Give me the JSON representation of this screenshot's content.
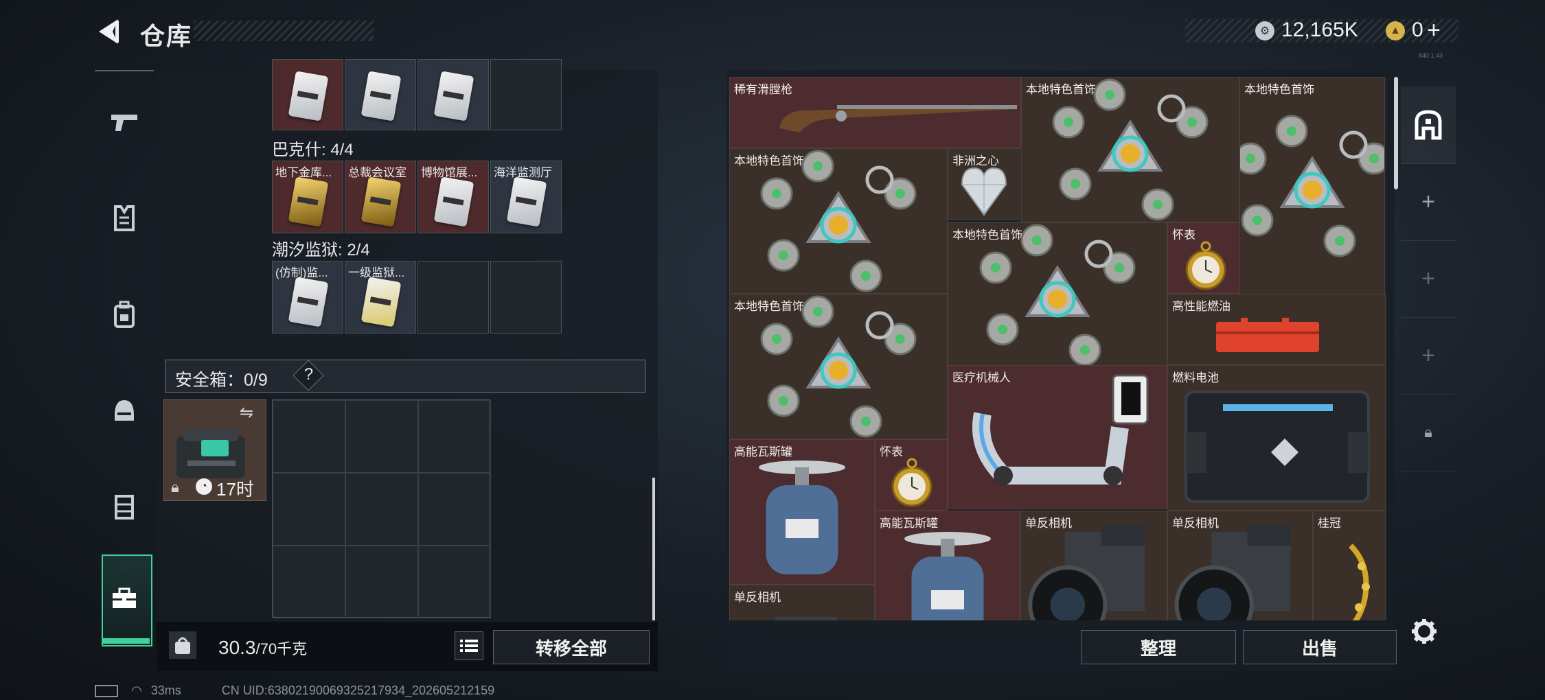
{
  "header": {
    "title": "仓库",
    "currency_main": "12,165K",
    "currency_secondary": "0",
    "add_label": "+",
    "version": "840.1.43"
  },
  "left_nav": {
    "items": [
      {
        "name": "weapon",
        "icon": "pistol-icon"
      },
      {
        "name": "armor",
        "icon": "vest-icon"
      },
      {
        "name": "backpack",
        "icon": "backpack-icon"
      },
      {
        "name": "helmet",
        "icon": "helmet-icon"
      },
      {
        "name": "chest-rig",
        "icon": "rig-icon"
      },
      {
        "name": "safe-case",
        "icon": "briefcase-icon",
        "active": true
      }
    ]
  },
  "left_panel": {
    "top_row": [
      "",
      "",
      ""
    ],
    "bakeshi": {
      "label": "巴克什: 4/4",
      "cards": [
        "地下金库...",
        "总裁会议室",
        "博物馆展...",
        "海洋监测厅"
      ]
    },
    "chaoxi": {
      "label": "潮汐监狱: 2/4",
      "cards": [
        "(仿制)监...",
        "一级监狱..."
      ]
    },
    "safe_box": {
      "label": "安全箱：0/9",
      "help": "?",
      "timer": "17时",
      "swap_icon": "swap-icon"
    },
    "weight": {
      "current": "30.3",
      "max": "/70千克"
    },
    "transfer_all": "转移全部"
  },
  "right_panel": {
    "items": [
      {
        "label": "稀有滑膛枪",
        "type": "musket"
      },
      {
        "label": "本地特色首饰",
        "type": "jewelry"
      },
      {
        "label": "本地特色首饰",
        "type": "jewelry"
      },
      {
        "label": "本地特色首饰",
        "type": "jewelry"
      },
      {
        "label": "非洲之心",
        "type": "gem"
      },
      {
        "label": "本地特色首饰",
        "type": "jewelry"
      },
      {
        "label": "怀表",
        "type": "watch"
      },
      {
        "label": "本地特色首饰",
        "type": "jewelry"
      },
      {
        "label": "高性能燃油",
        "type": "fuel"
      },
      {
        "label": "医疗机械人",
        "type": "robot"
      },
      {
        "label": "燃料电池",
        "type": "battery"
      },
      {
        "label": "高能瓦斯罐",
        "type": "gas"
      },
      {
        "label": "怀表",
        "type": "watch"
      },
      {
        "label": "高能瓦斯罐",
        "type": "gas"
      },
      {
        "label": "单反相机",
        "type": "camera"
      },
      {
        "label": "单反相机",
        "type": "camera"
      },
      {
        "label": "桂冠",
        "type": "crown"
      },
      {
        "label": "单反相机",
        "type": "camera"
      }
    ],
    "sort_button": "整理",
    "sell_button": "出售"
  },
  "status": {
    "ping": "33ms",
    "uid": "CN UID:6380219006932521​7934_202605212159"
  },
  "colors": {
    "accent": "#43d29b",
    "item_red": "#4c2c2e",
    "item_brown": "#3b3029"
  }
}
